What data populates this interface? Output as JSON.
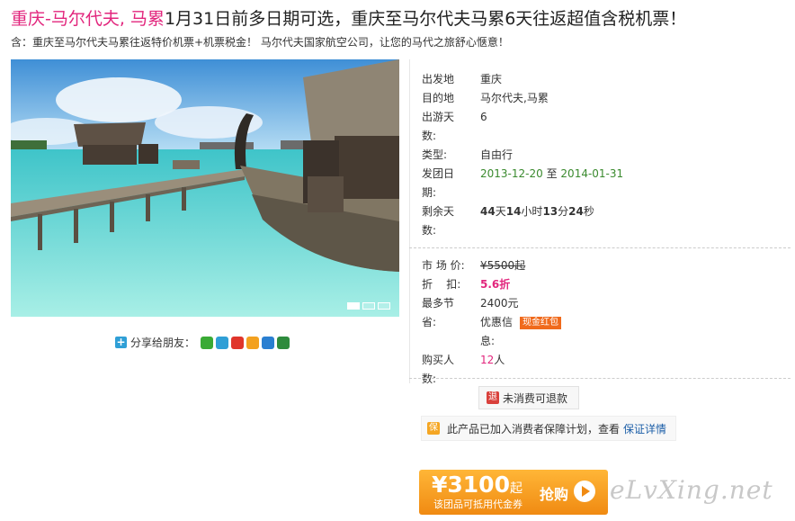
{
  "title": {
    "highlight": "重庆-马尔代夫, 马累",
    "rest": "1月31日前多日期可选，重庆至马尔代夫马累6天往返超值含税机票！"
  },
  "subtitle": "含：重庆至马尔代夫马累往返特价机票+机票税金！ 马尔代夫国家航空公司，让您的马代之旅舒心惬意！",
  "share": {
    "label": "分享给朋友：",
    "icons": [
      "weixin-icon",
      "qzone-icon",
      "weibo-icon",
      "star-icon",
      "renren-icon",
      "douban-icon"
    ]
  },
  "details": {
    "departure_label": "出发地",
    "departure_value": "重庆",
    "destination_label": "目的地",
    "destination_value": "马尔代夫,马累",
    "days_label_1": "出游天",
    "days_label_2": "数:",
    "days_value": "6",
    "type_label": "类型:",
    "type_value": "自由行",
    "date_label_1": "发团日",
    "date_label_2": "期:",
    "date_start": "2013-12-20",
    "date_sep": "至",
    "date_end": "2014-01-31",
    "remain_label_1": "剩余天",
    "remain_label_2": "数:",
    "remain_days": "44",
    "remain_days_unit": "天",
    "remain_hours": "14",
    "remain_hours_unit": "小时",
    "remain_mins": "13",
    "remain_mins_unit": "分",
    "remain_secs": "24",
    "remain_secs_unit": "秒"
  },
  "pricing": {
    "market_label": "市 场 价:",
    "market_value": "¥5500起",
    "discount_label": "折    扣:",
    "discount_value": "5.6折",
    "save_label_1": "最多节",
    "save_label_2": "省:",
    "save_value": "2400元",
    "coupon_line_1": "优惠信",
    "coupon_line_2": "息:",
    "coupon_badge": "现金红包",
    "buyers_label_1": "购买人",
    "buyers_label_2": "数:",
    "buyers_value": "12",
    "buyers_unit": "人"
  },
  "refund": {
    "icon": "退",
    "label": "未消费可退款"
  },
  "guarantee": {
    "icon": "保",
    "text": "此产品已加入消费者保障计划，查看",
    "link": "保证详情"
  },
  "buy": {
    "price": "¥3100",
    "price_suffix": "起",
    "sub": "该团品可抵用代金券",
    "action": "抢购"
  },
  "watermark": "eLvXing.net",
  "colors": {
    "accent_pink": "#e2267d",
    "date_green": "#3a8a2e",
    "buy_orange": "#f08a12"
  }
}
